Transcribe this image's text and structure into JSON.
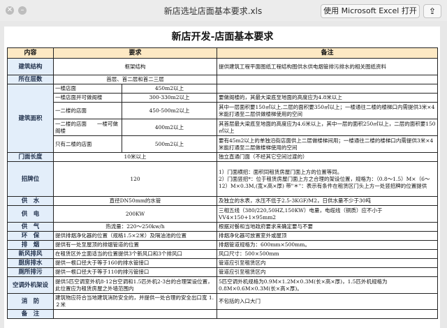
{
  "window": {
    "title": "新店选址店面基本要求.xls",
    "open_button": "使用 Microsoft Excel 打开",
    "share_icon": "share-icon"
  },
  "sheet": {
    "title": "新店开发-店面基本要求",
    "headers": [
      "内容",
      "要求",
      "备注"
    ],
    "rows": {
      "r1": {
        "cat": "建筑结构",
        "req": "框架结构",
        "note": "提供建筑工程平面图纸工程结构图供水供电烟管排污排水的相关图纸资料"
      },
      "r2": {
        "cat": "所在层数",
        "req": "首层、首二层和首二三层",
        "note": ""
      },
      "r3": {
        "cat": "建筑面积",
        "subs": [
          {
            "sub": "一楼店面",
            "req": "450m2以上",
            "note": ""
          },
          {
            "sub": "一楼店面并可做阁楼",
            "req": "300-330m2以上",
            "note": "要做阁楼的，其最大梁底至地面的高度应为4.8米以上"
          },
          {
            "sub": "一二楼的店面",
            "req": "450-500m2以上",
            "note": "其中一层面积要150㎡以上,二层的面积要350㎡以上；一楼通往二楼的楼梯口内需提供3米×4米能打通至二层供做楼梯使用的空间"
          },
          {
            "sub": "一二楼的店面　　一楼可做阁楼",
            "req": "400m2以上",
            "note": "其首层最大梁底至地面的高度应为4.6米以上，其中一层的面积250㎡以上，二层的面积要150㎡以上"
          },
          {
            "sub": "只有二楼的店面",
            "req": "500m2以上",
            "note": "要有45m2以上的单独沿街店面供上二层做楼梯间用；一楼通往二楼的楼梯口内需提供3米×4米能打通至二层做楼梯使用的空间"
          }
        ]
      },
      "r4": {
        "cat": "门面长度",
        "req": "10米以上",
        "note": "独立直通门面（不经其它空间过渡的）"
      },
      "r5": {
        "cat": "招牌位",
        "req": "120",
        "note": "1）门面横招：面积同租赁房屋门面上方的位置等同。\n2）门面竖招*：位于租赁房屋门面上方之合理的架设位置，规格为：（0.8～1.5）M×（6～12）M×0.3M,(宽×高×厚) 带\"＊\"：表示有条件在租赁区门头上方一处竖招牌的位置提供"
      },
      "r6": {
        "cat": "供　水",
        "req": "直径DN50mm的水管",
        "note": "及独立的水表，水压不低于2.5-3KGF/M2，日供水量不少于30吨"
      },
      "r7": {
        "cat": "供　电",
        "req": "200KW",
        "note": "三相五线（380/220,50HZ,150KW）电量，电缆线（铜质）应不小于VV4×150+1×95mm2"
      },
      "r8": {
        "cat": "供　气",
        "req": "热流量：220～250kw/h",
        "note": "根据对餐和当地政府要求来确定要与不要"
      },
      "r9": {
        "cat": "环　保",
        "req": "提供排烟净化器的位置（规格1.5×2米）及隔油池的位置",
        "note": "排烟净化器可放置室外或屋顶"
      },
      "r10": {
        "cat": "排　烟",
        "req": "提供有一处至屋顶的排烟管道的位置",
        "note": "排烟管道规格为：600mm×500mm。"
      },
      "r11": {
        "cat": "新风排风",
        "req": "在租赁区外立面适当的位置提供3个新风口和3个排风口",
        "note": "风口尺寸：500×500mm"
      },
      "r12": {
        "cat": "厨房排水",
        "req": "提供一根口径大于等于160的排水管接口",
        "note": "管道应引至租赁区内"
      },
      "r13": {
        "cat": "厕所排污",
        "req": "提供一根口径大于等于110的排污管接口",
        "note": "管道应引至租赁区内"
      },
      "r14": {
        "cat": "空调外机架设",
        "req": "提供5匹空调室外机8-12台空调和1.5匹外机2-3台的合理架设位置，此位置应为租赁房屋之外墙范围内",
        "note": "5匹空调外机规格为0.9M×1.2M×0.3M(长×高×厚)，1.5匹外机规格为0.8M×0.6M×0.3M(长×高×厚)。"
      },
      "r15": {
        "cat": "消　防",
        "req": "建筑物应符合当地建筑消防安全的，并提供一处合理的安全出口宽 1.２米",
        "note": "不包括的入口大门"
      },
      "r16": {
        "cat": "备　注",
        "req": "",
        "note": ""
      }
    }
  }
}
